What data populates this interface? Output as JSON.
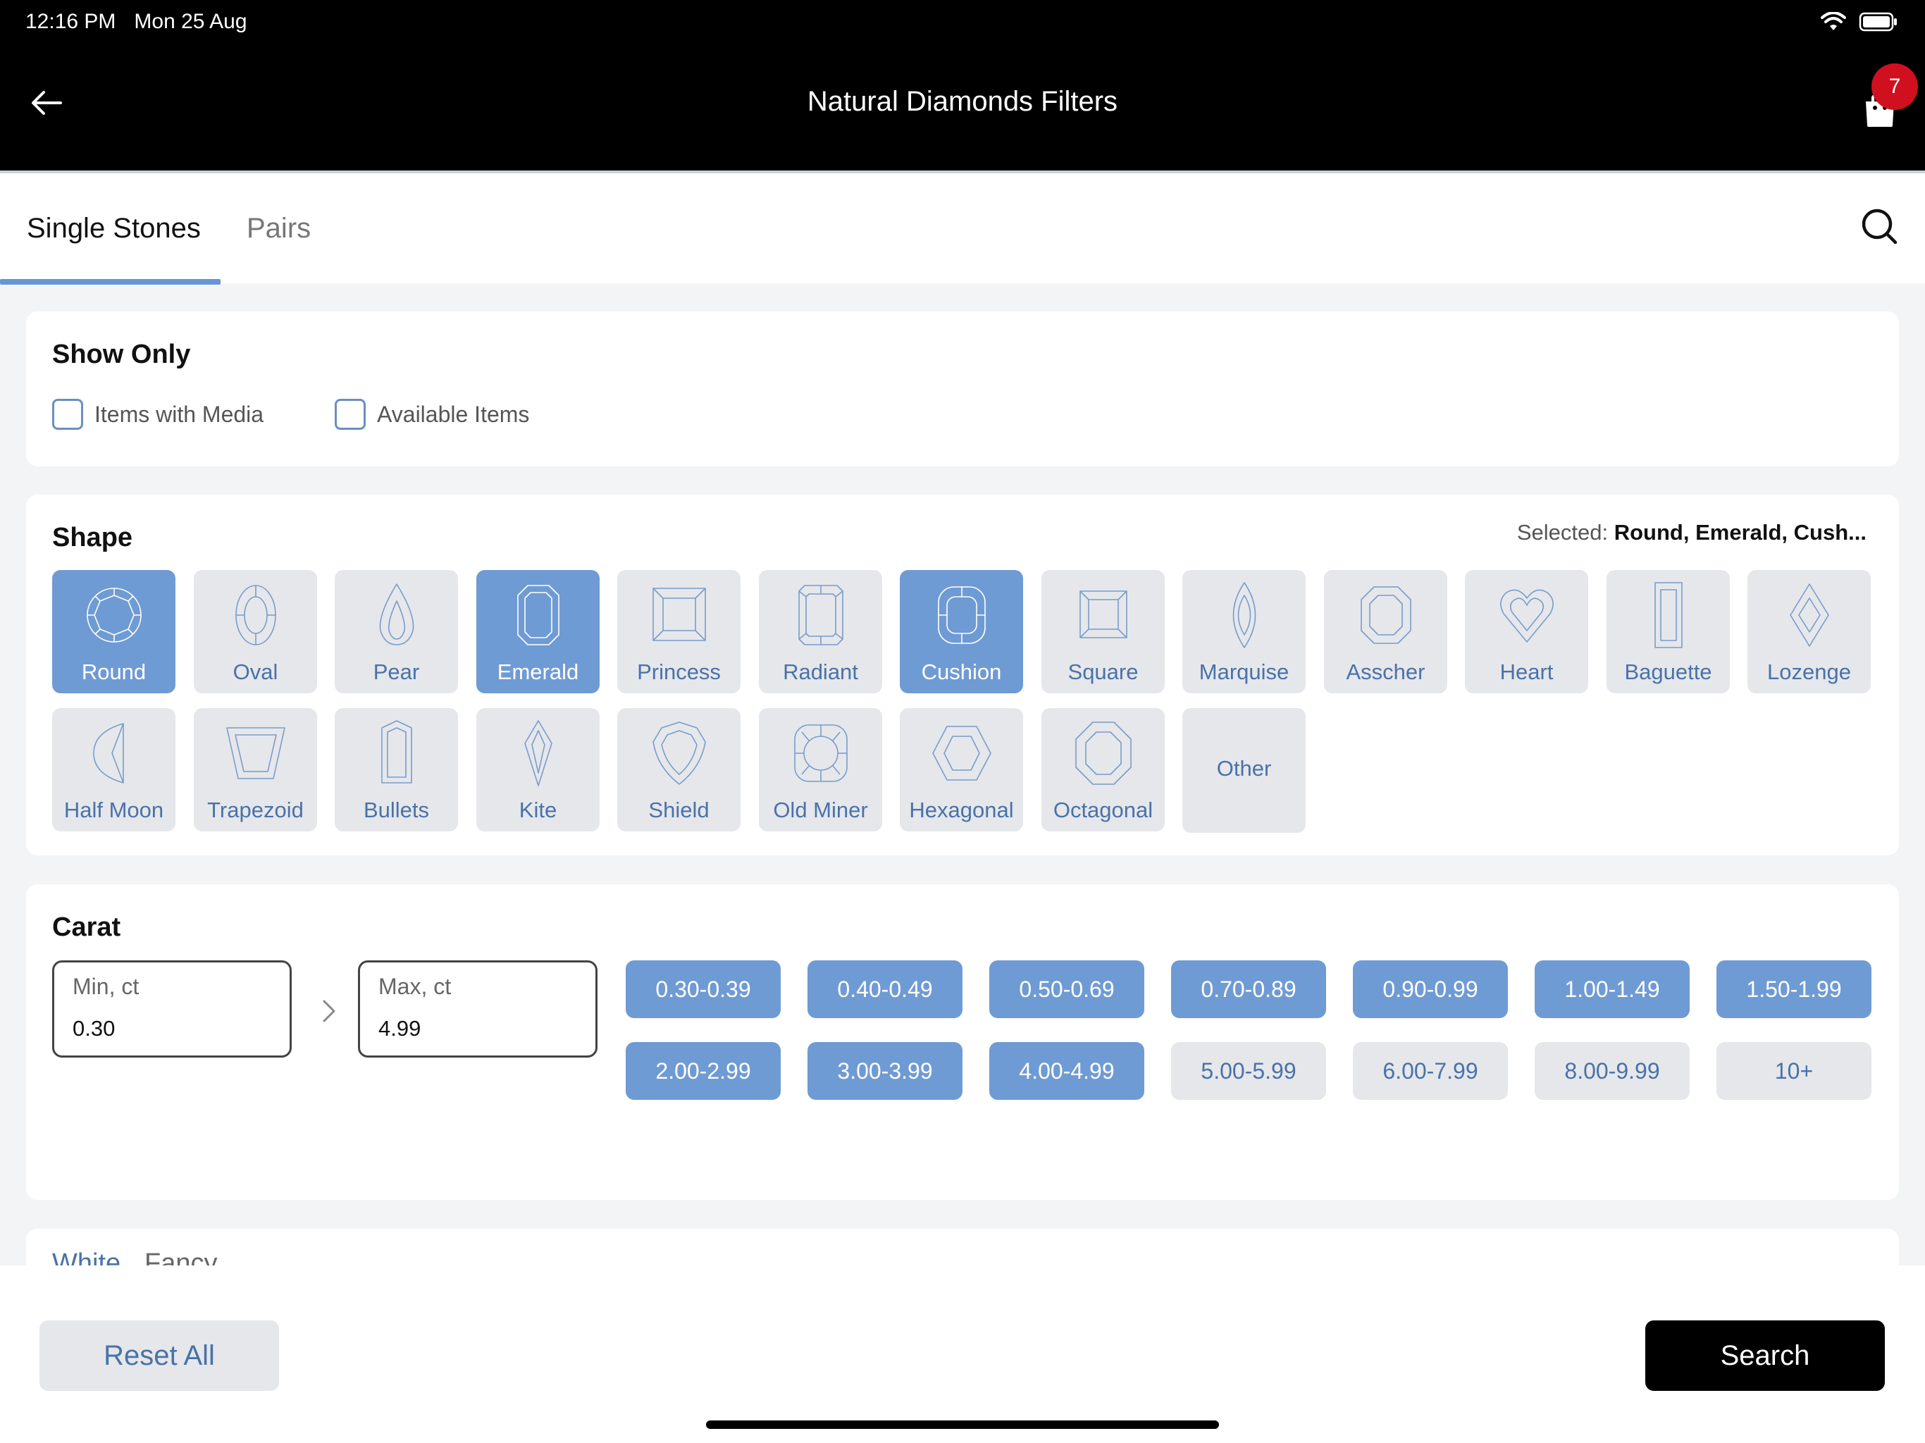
{
  "status_bar": {
    "time": "12:16 PM",
    "date": "Mon 25 Aug"
  },
  "nav": {
    "title": "Natural Diamonds Filters",
    "cart_count": "7"
  },
  "tabs": [
    {
      "label": "Single Stones",
      "active": true
    },
    {
      "label": "Pairs",
      "active": false
    }
  ],
  "show_only": {
    "title": "Show Only",
    "options": [
      {
        "label": "Items with Media",
        "checked": false
      },
      {
        "label": "Available Items",
        "checked": false
      }
    ]
  },
  "shape": {
    "title": "Shape",
    "selected_prefix": "Selected:",
    "selected_value": "Round, Emerald, Cush...",
    "items": [
      {
        "label": "Round",
        "icon": "round-shape-icon",
        "selected": true
      },
      {
        "label": "Oval",
        "icon": "oval-shape-icon",
        "selected": false
      },
      {
        "label": "Pear",
        "icon": "pear-shape-icon",
        "selected": false
      },
      {
        "label": "Emerald",
        "icon": "emerald-shape-icon",
        "selected": true
      },
      {
        "label": "Princess",
        "icon": "princess-shape-icon",
        "selected": false
      },
      {
        "label": "Radiant",
        "icon": "radiant-shape-icon",
        "selected": false
      },
      {
        "label": "Cushion",
        "icon": "cushion-shape-icon",
        "selected": true
      },
      {
        "label": "Square",
        "icon": "square-shape-icon",
        "selected": false
      },
      {
        "label": "Marquise",
        "icon": "marquise-shape-icon",
        "selected": false
      },
      {
        "label": "Asscher",
        "icon": "asscher-shape-icon",
        "selected": false
      },
      {
        "label": "Heart",
        "icon": "heart-shape-icon",
        "selected": false
      },
      {
        "label": "Baguette",
        "icon": "baguette-shape-icon",
        "selected": false
      },
      {
        "label": "Lozenge",
        "icon": "lozenge-shape-icon",
        "selected": false
      },
      {
        "label": "Half Moon",
        "icon": "half-moon-shape-icon",
        "selected": false
      },
      {
        "label": "Trapezoid",
        "icon": "trapezoid-shape-icon",
        "selected": false
      },
      {
        "label": "Bullets",
        "icon": "bullets-shape-icon",
        "selected": false
      },
      {
        "label": "Kite",
        "icon": "kite-shape-icon",
        "selected": false
      },
      {
        "label": "Shield",
        "icon": "shield-shape-icon",
        "selected": false
      },
      {
        "label": "Old Miner",
        "icon": "old-miner-shape-icon",
        "selected": false
      },
      {
        "label": "Hexagonal",
        "icon": "hexagonal-shape-icon",
        "selected": false
      },
      {
        "label": "Octagonal",
        "icon": "octagonal-shape-icon",
        "selected": false
      },
      {
        "label": "Other",
        "icon": "",
        "selected": false
      }
    ]
  },
  "carat": {
    "title": "Carat",
    "min_label": "Min, ct",
    "min_value": "0.30",
    "max_label": "Max, ct",
    "max_value": "4.99",
    "ranges": [
      {
        "label": "0.30-0.39",
        "selected": true
      },
      {
        "label": "0.40-0.49",
        "selected": true
      },
      {
        "label": "0.50-0.69",
        "selected": true
      },
      {
        "label": "0.70-0.89",
        "selected": true
      },
      {
        "label": "0.90-0.99",
        "selected": true
      },
      {
        "label": "1.00-1.49",
        "selected": true
      },
      {
        "label": "1.50-1.99",
        "selected": true
      },
      {
        "label": "2.00-2.99",
        "selected": true
      },
      {
        "label": "3.00-3.99",
        "selected": true
      },
      {
        "label": "4.00-4.99",
        "selected": true
      },
      {
        "label": "5.00-5.99",
        "selected": false
      },
      {
        "label": "6.00-7.99",
        "selected": false
      },
      {
        "label": "8.00-9.99",
        "selected": false
      },
      {
        "label": "10+",
        "selected": false
      }
    ]
  },
  "color": {
    "tabs": [
      "White",
      "Fancy"
    ]
  },
  "footer": {
    "reset_label": "Reset All",
    "search_label": "Search"
  },
  "colors": {
    "accent": "#6f9bd4",
    "accent_text": "#4a72a8",
    "tile_bg": "#e5e7eb",
    "badge": "#d0101f"
  }
}
